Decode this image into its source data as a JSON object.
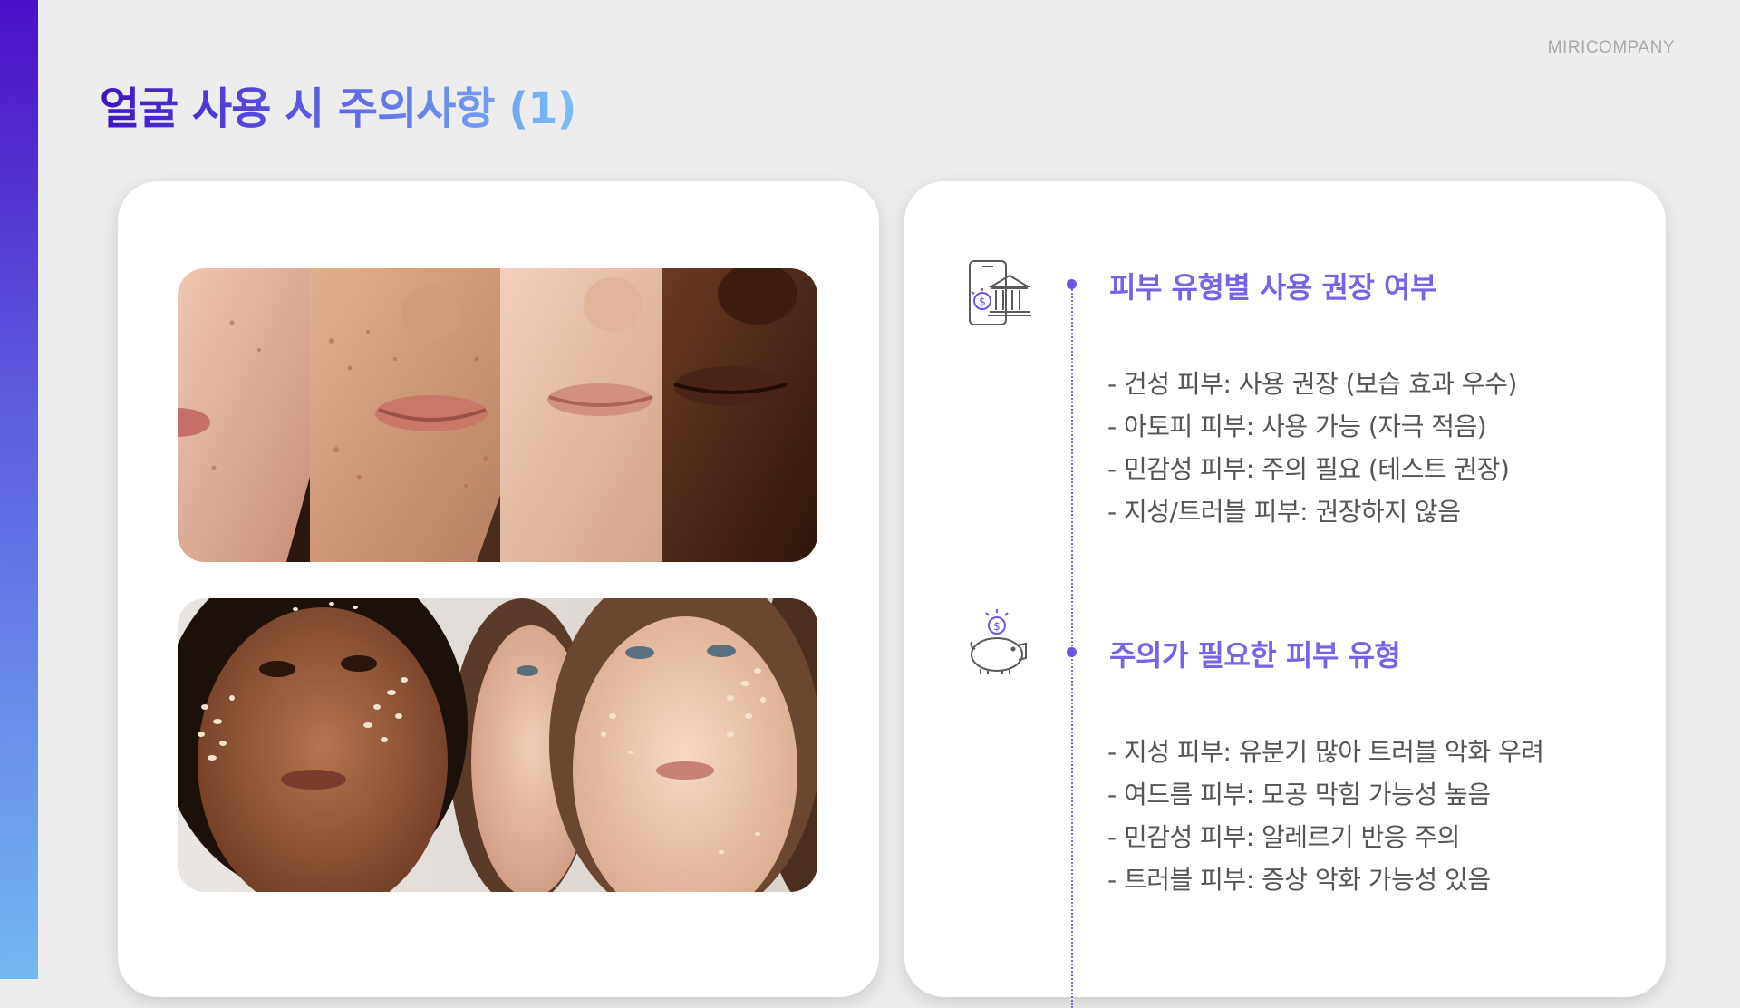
{
  "brand": "MIRICOMPANY",
  "title": "얼굴 사용 시 주의사항 (1)",
  "colors": {
    "accent_dark": "#3f13c4",
    "accent_mid": "#5d5ce2",
    "accent_light": "#7cbef5",
    "heading": "#7a62e8",
    "body_text": "#555555",
    "background": "#ededed"
  },
  "photos": [
    {
      "icon": "face-closeup-skin-types-photo"
    },
    {
      "icon": "faces-with-cream-dots-photo"
    }
  ],
  "sections": [
    {
      "icon": "mobile-bank-icon",
      "heading": "피부 유형별 사용 권장 여부",
      "items": [
        "- 건성 피부: 사용 권장 (보습 효과 우수)",
        "- 아토피 피부: 사용 가능 (자극 적음)",
        "- 민감성 피부: 주의 필요 (테스트 권장)",
        "- 지성/트러블 피부: 권장하지 않음"
      ]
    },
    {
      "icon": "piggy-bank-icon",
      "heading": "주의가 필요한 피부 유형",
      "items": [
        "- 지성 피부: 유분기 많아 트러블 악화 우려",
        "- 여드름 피부: 모공 막힘 가능성 높음",
        "- 민감성 피부: 알레르기 반응 주의",
        "- 트러블 피부: 증상 악화 가능성 있음"
      ]
    }
  ]
}
